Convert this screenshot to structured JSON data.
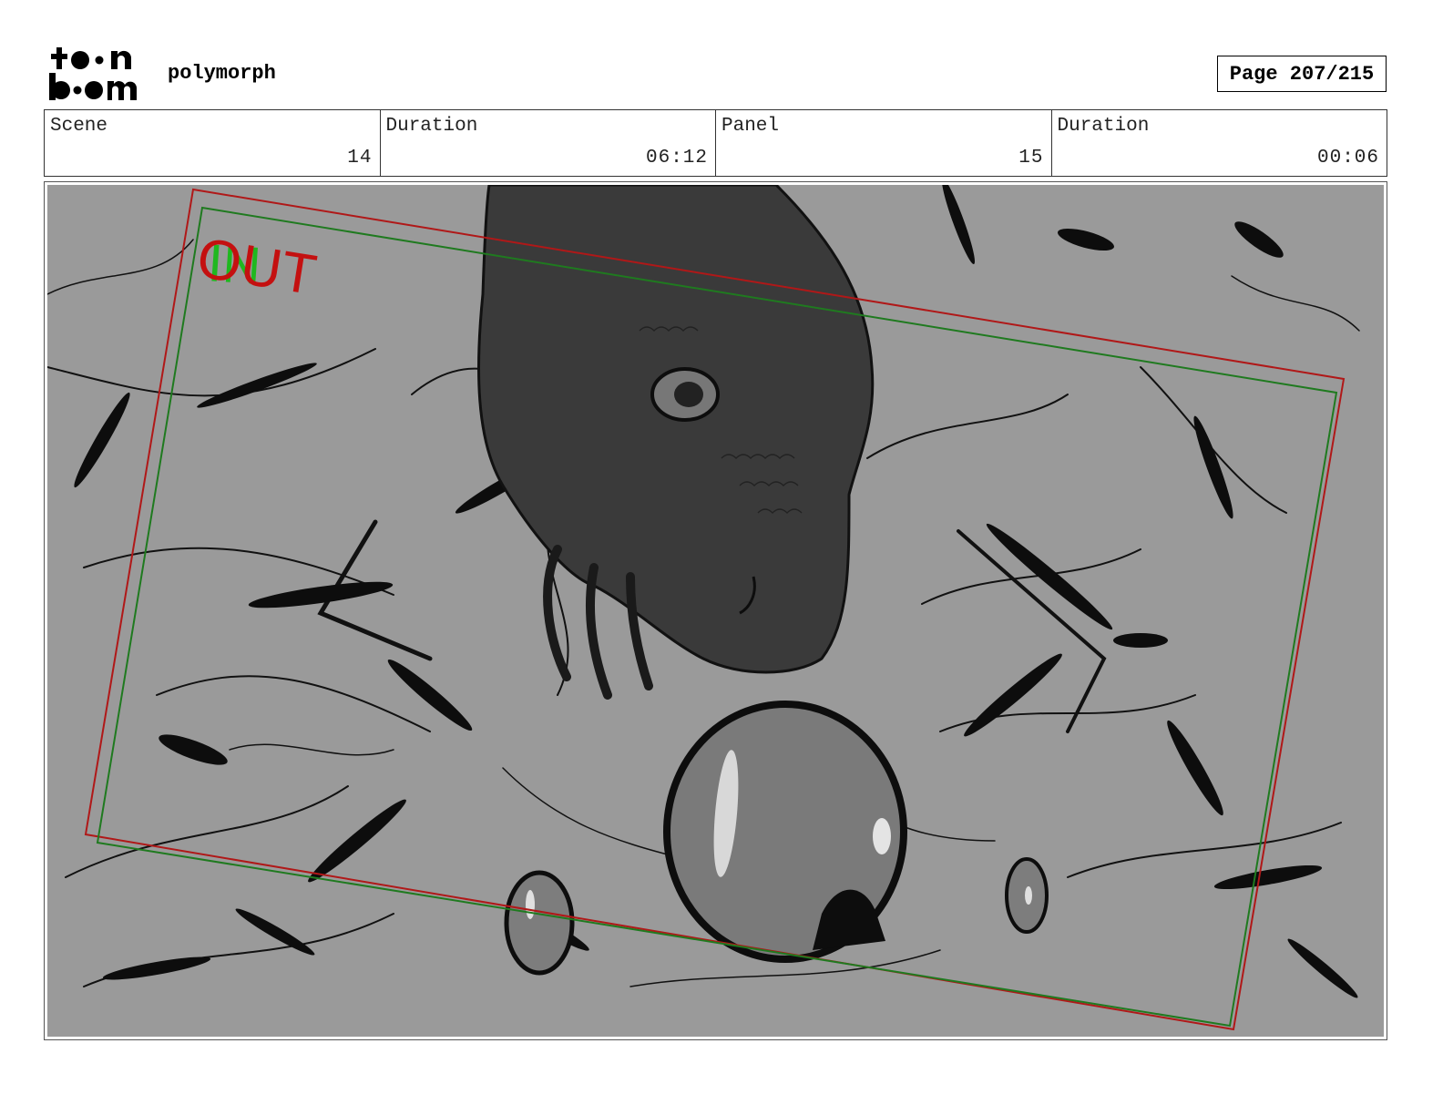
{
  "header": {
    "logo_text_top": "toon",
    "logo_text_bottom": "boom",
    "project_title": "polymorph",
    "page_label": "Page 207/215"
  },
  "info": {
    "scene_label": "Scene",
    "scene_value": "14",
    "scene_duration_label": "Duration",
    "scene_duration_value": "06:12",
    "panel_label": "Panel",
    "panel_value": "15",
    "panel_duration_label": "Duration",
    "panel_duration_value": "00:06"
  },
  "panel": {
    "in_label": "IN",
    "out_label": "OUT",
    "colors": {
      "background": "#9a9a9a",
      "creature": "#3a3a3a",
      "in_frame": "#1f7a1f",
      "out_frame": "#b01818"
    }
  }
}
